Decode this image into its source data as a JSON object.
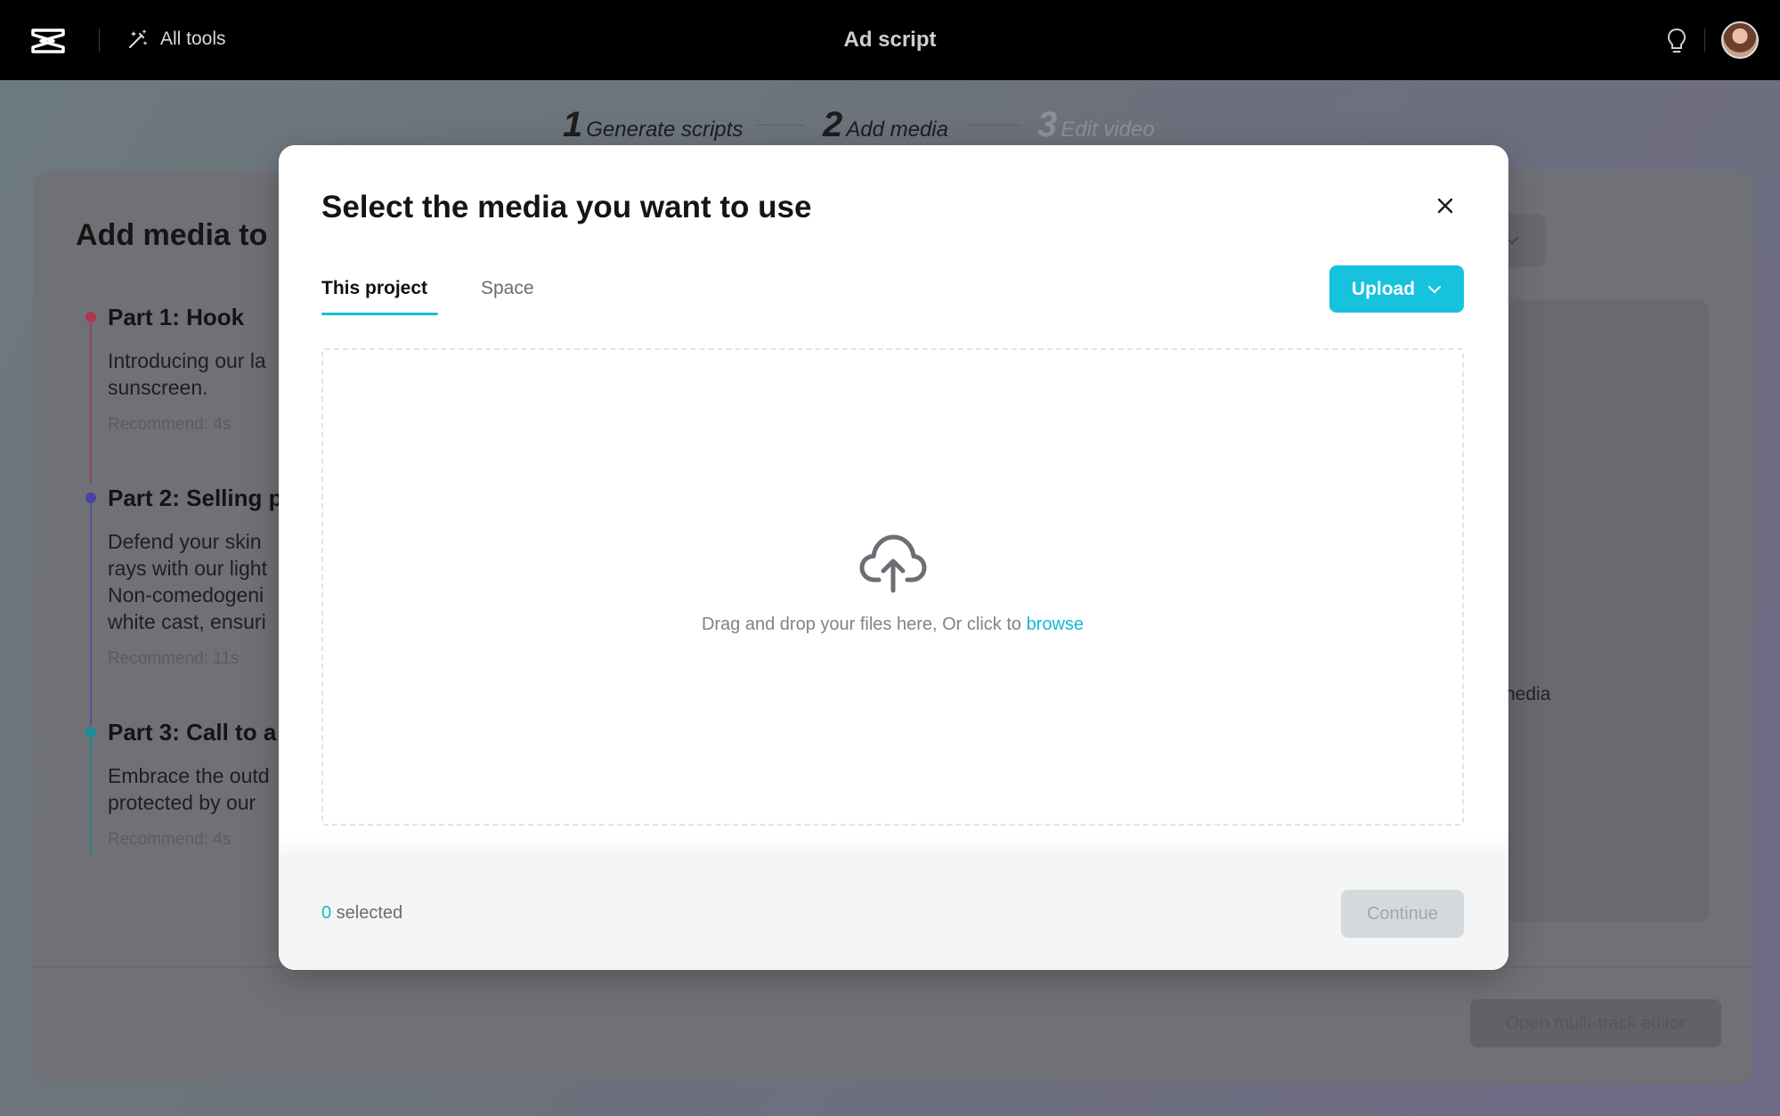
{
  "topbar": {
    "all_tools_label": "All tools",
    "title": "Ad script"
  },
  "stepper": {
    "steps": [
      {
        "num": "1",
        "label": "Generate scripts",
        "state": "done"
      },
      {
        "num": "2",
        "label": "Add media",
        "state": "current"
      },
      {
        "num": "3",
        "label": "Edit video",
        "state": "future"
      }
    ]
  },
  "background": {
    "heading": "Add media to",
    "parts": [
      {
        "title": "Part 1: Hook",
        "text": "Introducing our la\nsunscreen.",
        "recommend": "Recommend: 4s",
        "color": "#b0344f"
      },
      {
        "title": "Part 2: Selling p",
        "text": "Defend your skin\nrays with our light\nNon-comedogeni\nwhite cast, ensuri",
        "recommend": "Recommend: 11s",
        "color": "#4b3fa8"
      },
      {
        "title": "Part 3: Call to a",
        "text": "Embrace the outd\nprotected by our",
        "recommend": "Recommend: 4s",
        "color": "#1a8d99"
      }
    ],
    "media_label": "nedia",
    "editor_button": "Open multi-track editor"
  },
  "modal": {
    "title": "Select the media you want to use",
    "tabs": [
      {
        "label": "This project",
        "active": true
      },
      {
        "label": "Space",
        "active": false
      }
    ],
    "upload_label": "Upload",
    "drop_text": "Drag and drop your files here, Or click to ",
    "browse_label": "browse",
    "selected_count": "0",
    "selected_suffix": " selected",
    "continue_label": "Continue"
  },
  "colors": {
    "accent": "#16c2dc",
    "link": "#16b8d2"
  },
  "icons": [
    "capcut-logo-icon",
    "magic-wand-icon",
    "lightbulb-icon",
    "close-icon",
    "chevron-down-icon",
    "cloud-upload-icon"
  ]
}
